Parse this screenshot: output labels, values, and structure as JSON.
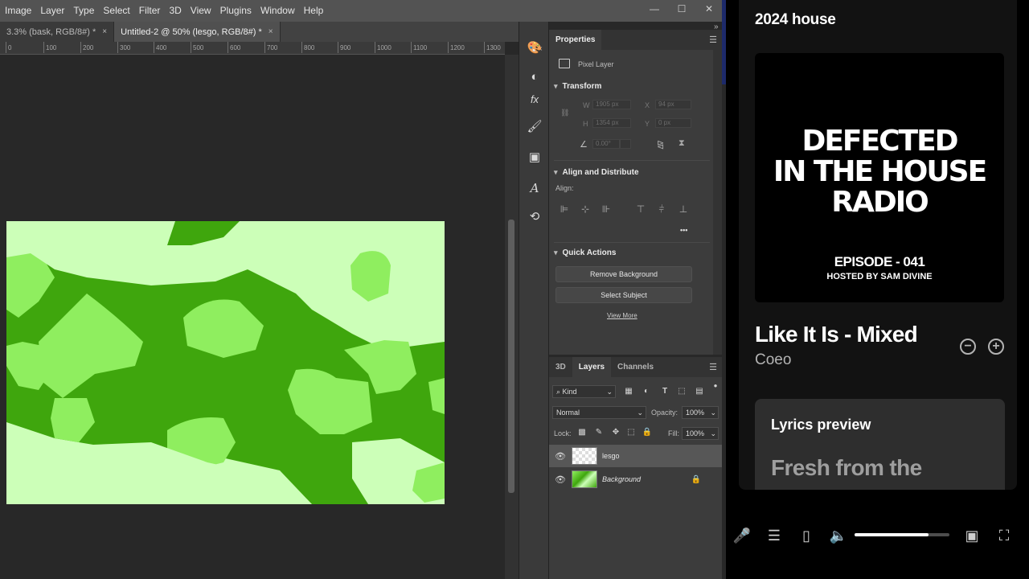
{
  "photoshop": {
    "menu": [
      "Image",
      "Layer",
      "Type",
      "Select",
      "Filter",
      "3D",
      "View",
      "Plugins",
      "Window",
      "Help"
    ],
    "window_controls": [
      "—",
      "☐",
      "✕"
    ],
    "tabs": [
      {
        "label": "3.3% (bask, RGB/8#) *",
        "close": "×"
      },
      {
        "label": "Untitled-2 @ 50% (lesgo, RGB/8#) *",
        "close": "×"
      }
    ],
    "ruler_ticks": [
      "0",
      "100",
      "200",
      "300",
      "400",
      "500",
      "600",
      "700",
      "800",
      "900",
      "1000",
      "1100",
      "1200",
      "1300"
    ],
    "properties": {
      "tab": "Properties",
      "pixel_layer": "Pixel Layer",
      "transform": "Transform",
      "w_label": "W",
      "w_value": "1905 px",
      "x_label": "X",
      "x_value": "94 px",
      "h_label": "H",
      "h_value": "1354 px",
      "y_label": "Y",
      "y_value": "0 px",
      "angle_value": "0.00°",
      "align_distribute": "Align and Distribute",
      "align_label": "Align:",
      "more": "•••",
      "quick_actions": "Quick Actions",
      "remove_bg": "Remove Background",
      "select_subject": "Select Subject",
      "view_more": "View More"
    },
    "layers_panel": {
      "tabs": [
        "3D",
        "Layers",
        "Channels"
      ],
      "kind": "Kind",
      "blend_mode": "Normal",
      "opacity_label": "Opacity:",
      "opacity_value": "100%",
      "lock_label": "Lock:",
      "fill_label": "Fill:",
      "fill_value": "100%",
      "layers": [
        {
          "name": "lesgo",
          "selected": true
        },
        {
          "name": "Background",
          "selected": false,
          "locked": true
        }
      ]
    }
  },
  "spotify": {
    "playlist_title": "2024 house",
    "cover": {
      "line1": "DEFECTED",
      "line2": "IN THE HOUSE",
      "line3": "RADIO",
      "episode": "EPISODE - 041",
      "host": "HOSTED BY SAM DIVINE"
    },
    "track_title": "Like It Is - Mixed",
    "artist": "Coeo",
    "lyrics_header": "Lyrics preview",
    "lyrics_line": "Fresh from the",
    "volume_level": 0.78
  },
  "colors": {
    "canvas_light": "#ccffb8",
    "canvas_mid": "#8fee5f",
    "canvas_dark": "#3fa60d"
  }
}
